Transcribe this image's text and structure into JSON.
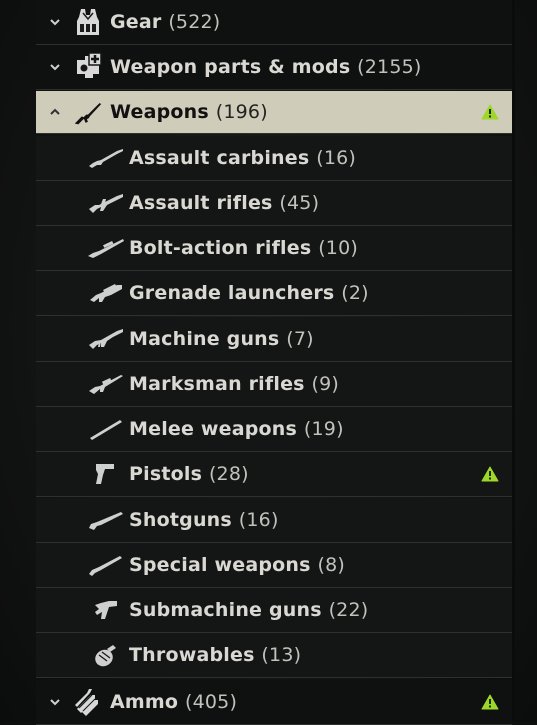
{
  "colors": {
    "active_bg": "#cfccba",
    "warning": "#9fd62a",
    "text": "#d9d8d2"
  },
  "categories": [
    {
      "label": "Gear",
      "count": "(522)",
      "icon": "gear-vest-icon",
      "expanded": false,
      "warning": false
    },
    {
      "label": "Weapon parts & mods",
      "count": "(2155)",
      "icon": "weapon-mods-icon",
      "expanded": false,
      "warning": false
    },
    {
      "label": "Weapons",
      "count": "(196)",
      "icon": "rifle-icon",
      "expanded": true,
      "selected": true,
      "warning": true
    },
    {
      "label": "Ammo",
      "count": "(405)",
      "icon": "ammo-icon",
      "expanded": false,
      "warning": true
    }
  ],
  "weapons_subcategories": [
    {
      "label": "Assault carbines",
      "count": "(16)",
      "icon": "assault-carbine-icon",
      "warning": false
    },
    {
      "label": "Assault rifles",
      "count": "(45)",
      "icon": "assault-rifle-icon",
      "warning": false
    },
    {
      "label": "Bolt-action rifles",
      "count": "(10)",
      "icon": "bolt-action-rifle-icon",
      "warning": false
    },
    {
      "label": "Grenade launchers",
      "count": "(2)",
      "icon": "grenade-launcher-icon",
      "warning": false
    },
    {
      "label": "Machine guns",
      "count": "(7)",
      "icon": "machine-gun-icon",
      "warning": false
    },
    {
      "label": "Marksman rifles",
      "count": "(9)",
      "icon": "marksman-rifle-icon",
      "warning": false
    },
    {
      "label": "Melee weapons",
      "count": "(19)",
      "icon": "melee-weapon-icon",
      "warning": false
    },
    {
      "label": "Pistols",
      "count": "(28)",
      "icon": "pistol-icon",
      "warning": true
    },
    {
      "label": "Shotguns",
      "count": "(16)",
      "icon": "shotgun-icon",
      "warning": false
    },
    {
      "label": "Special weapons",
      "count": "(8)",
      "icon": "special-weapon-icon",
      "warning": false
    },
    {
      "label": "Submachine guns",
      "count": "(22)",
      "icon": "submachine-gun-icon",
      "warning": false
    },
    {
      "label": "Throwables",
      "count": "(13)",
      "icon": "grenade-icon",
      "warning": false
    }
  ]
}
